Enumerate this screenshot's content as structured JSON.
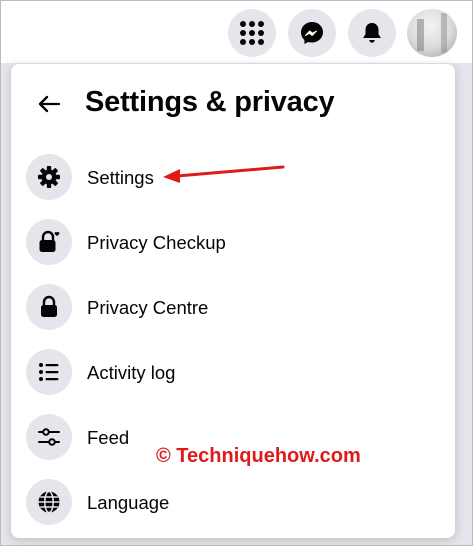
{
  "topbar": {
    "buttons": [
      {
        "name": "menu-grid",
        "icon": "grid-icon"
      },
      {
        "name": "messenger",
        "icon": "messenger-icon"
      },
      {
        "name": "notifications",
        "icon": "bell-icon"
      }
    ],
    "avatar": "profile-picture"
  },
  "panel": {
    "title": "Settings & privacy",
    "back_icon": "back-arrow-icon",
    "items": [
      {
        "label": "Settings",
        "icon": "gear-icon"
      },
      {
        "label": "Privacy Checkup",
        "icon": "lock-heart-icon"
      },
      {
        "label": "Privacy Centre",
        "icon": "lock-icon"
      },
      {
        "label": "Activity log",
        "icon": "list-icon"
      },
      {
        "label": "Feed",
        "icon": "sliders-icon"
      },
      {
        "label": "Language",
        "icon": "globe-icon"
      }
    ]
  },
  "annotation": {
    "color": "#e01919"
  },
  "watermark": "© Techniquehow.com",
  "colors": {
    "icon_bg": "#e4e6eb",
    "text": "#050505",
    "accent": "#e01919"
  }
}
